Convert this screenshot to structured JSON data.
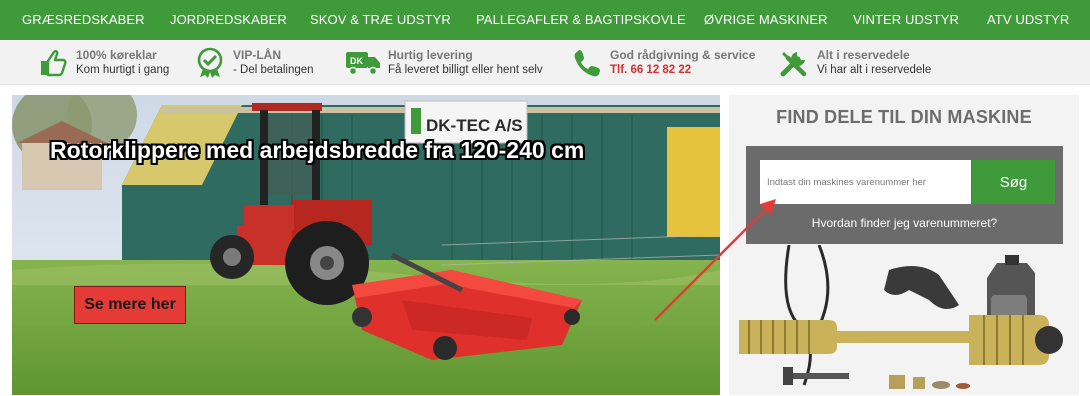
{
  "nav": {
    "items": [
      {
        "label": "GRÆSREDSKABER"
      },
      {
        "label": "JORDREDSKABER"
      },
      {
        "label": "SKOV & TRÆ UDSTYR"
      },
      {
        "label": "PALLEGAFLER & BAGTIPSKOVLE"
      },
      {
        "label": "ØVRIGE MASKINER"
      },
      {
        "label": "VINTER UDSTYR"
      },
      {
        "label": "ATV UDSTYR"
      }
    ]
  },
  "usp": {
    "items": [
      {
        "title": "100% køreklar",
        "sub": "Kom hurtigt i gang",
        "icon": "thumbs-up-icon"
      },
      {
        "title": "VIP-LÅN",
        "sub": "- Del betalingen",
        "icon": "check-badge-icon"
      },
      {
        "title": "Hurtig levering",
        "sub": "Få leveret billigt eller hent selv",
        "icon": "delivery-truck-icon",
        "badge": "DK"
      },
      {
        "title": "God rådgivning & service",
        "sub": "Tlf. 66 12 82 22",
        "icon": "phone-icon"
      },
      {
        "title": "Alt i reservedele",
        "sub": "Vi har alt i reservedele",
        "icon": "tools-icon"
      }
    ]
  },
  "hero": {
    "title": "Rotorklippere med arbejdsbredde fra 120-240 cm",
    "cta": "Se mere her",
    "sign": "DK-TEC A/S"
  },
  "finder": {
    "title": "FIND DELE TIL DIN MASKINE",
    "input_placeholder": "Indtast din maskines varenummer her",
    "button": "Søg",
    "help_link": "Hvordan finder jeg varenummeret?"
  },
  "colors": {
    "brand_green": "#3f9a3a",
    "accent_red": "#e53b36",
    "finder_grey": "#6b6b6b"
  }
}
